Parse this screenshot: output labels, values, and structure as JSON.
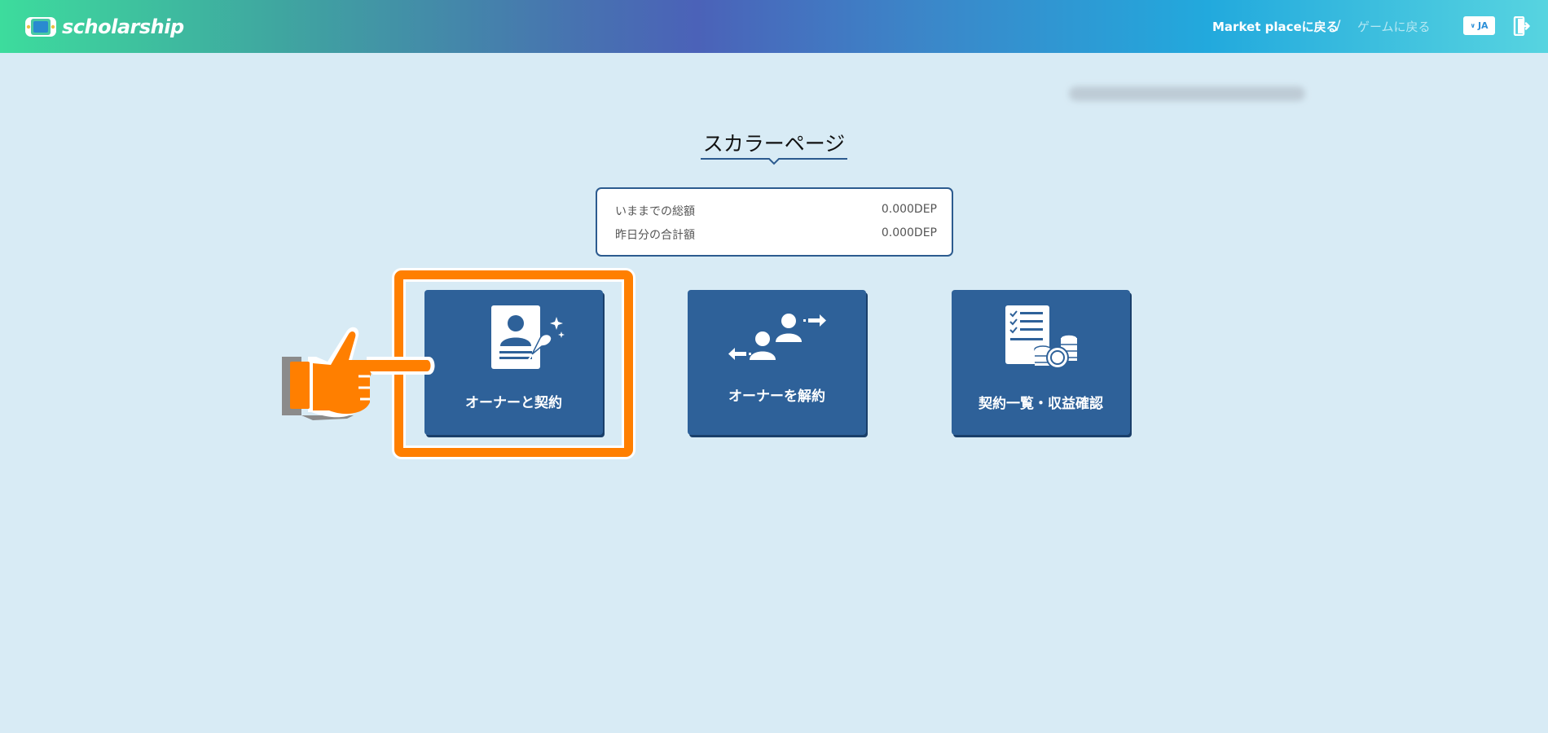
{
  "header": {
    "logo_text": "scholarship",
    "nav_marketplace_label": "Market placeに戻る",
    "nav_separator": "/",
    "nav_game_label": "ゲームに戻る",
    "language": "JA",
    "icons": {
      "language_chevron": "chevron-down-icon",
      "logout": "logout-icon"
    }
  },
  "main": {
    "title": "スカラーページ",
    "summary": {
      "rows": [
        {
          "label": "いままでの総額",
          "value": "0.000DEP"
        },
        {
          "label": "昨日分の合計額",
          "value": "0.000DEP"
        }
      ]
    },
    "tiles": [
      {
        "label": "オーナーと契約",
        "icon": "contract-signing-icon",
        "highlighted": true
      },
      {
        "label": "オーナーを解約",
        "icon": "user-exchange-icon",
        "highlighted": false
      },
      {
        "label": "契約一覧・収益確認",
        "icon": "list-coins-icon",
        "highlighted": false
      }
    ]
  },
  "colors": {
    "background": "#d8ebf5",
    "tile": "#2e6199",
    "highlight": "#ff7f00",
    "summary_border": "#2c5b8f"
  }
}
